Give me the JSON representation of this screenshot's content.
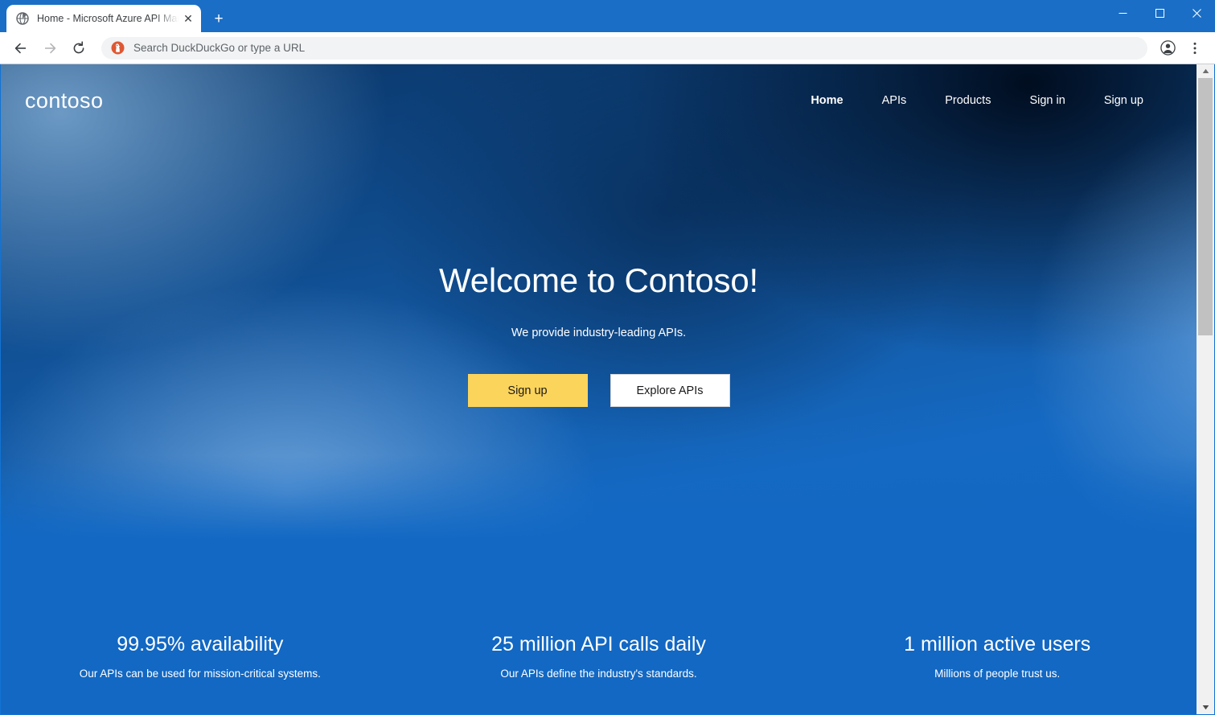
{
  "browser": {
    "tab": {
      "favicon": "globe-icon",
      "title": "Home - Microsoft Azure API Man",
      "close_label": "✕"
    },
    "new_tab_label": "+",
    "window_controls": {
      "minimize": "minimize-icon",
      "maximize": "maximize-icon",
      "close": "close-icon"
    },
    "toolbar": {
      "back": "back-arrow-icon",
      "forward": "forward-arrow-icon",
      "reload": "reload-icon",
      "omnibox_placeholder": "Search DuckDuckGo or type a URL",
      "omnibox_value": "",
      "search_engine_icon": "duckduckgo-icon",
      "profile": "profile-avatar-icon",
      "menu": "three-dot-menu-icon"
    },
    "scrollbar": {
      "up_arrow": "▲",
      "down_arrow": "▼"
    }
  },
  "site": {
    "logo": "contoso",
    "nav": [
      {
        "label": "Home",
        "active": true
      },
      {
        "label": "APIs",
        "active": false
      },
      {
        "label": "Products",
        "active": false
      },
      {
        "label": "Sign in",
        "active": false
      },
      {
        "label": "Sign up",
        "active": false
      }
    ],
    "hero": {
      "title": "Welcome to Contoso!",
      "subtitle": "We provide industry-leading APIs.",
      "primary_button": "Sign up",
      "secondary_button": "Explore APIs"
    },
    "stats": [
      {
        "value": "99.95% availability",
        "description": "Our APIs can be used for mission-critical systems."
      },
      {
        "value": "25 million API calls daily",
        "description": "Our APIs define the industry's standards."
      },
      {
        "value": "1 million active users",
        "description": "Millions of people trust us."
      }
    ]
  },
  "colors": {
    "chrome_blue": "#1a6ec6",
    "hero_dark": "#0a3566",
    "stats_blue": "#1268c3",
    "primary_button": "#fbd45c",
    "accent_white": "#ffffff"
  }
}
